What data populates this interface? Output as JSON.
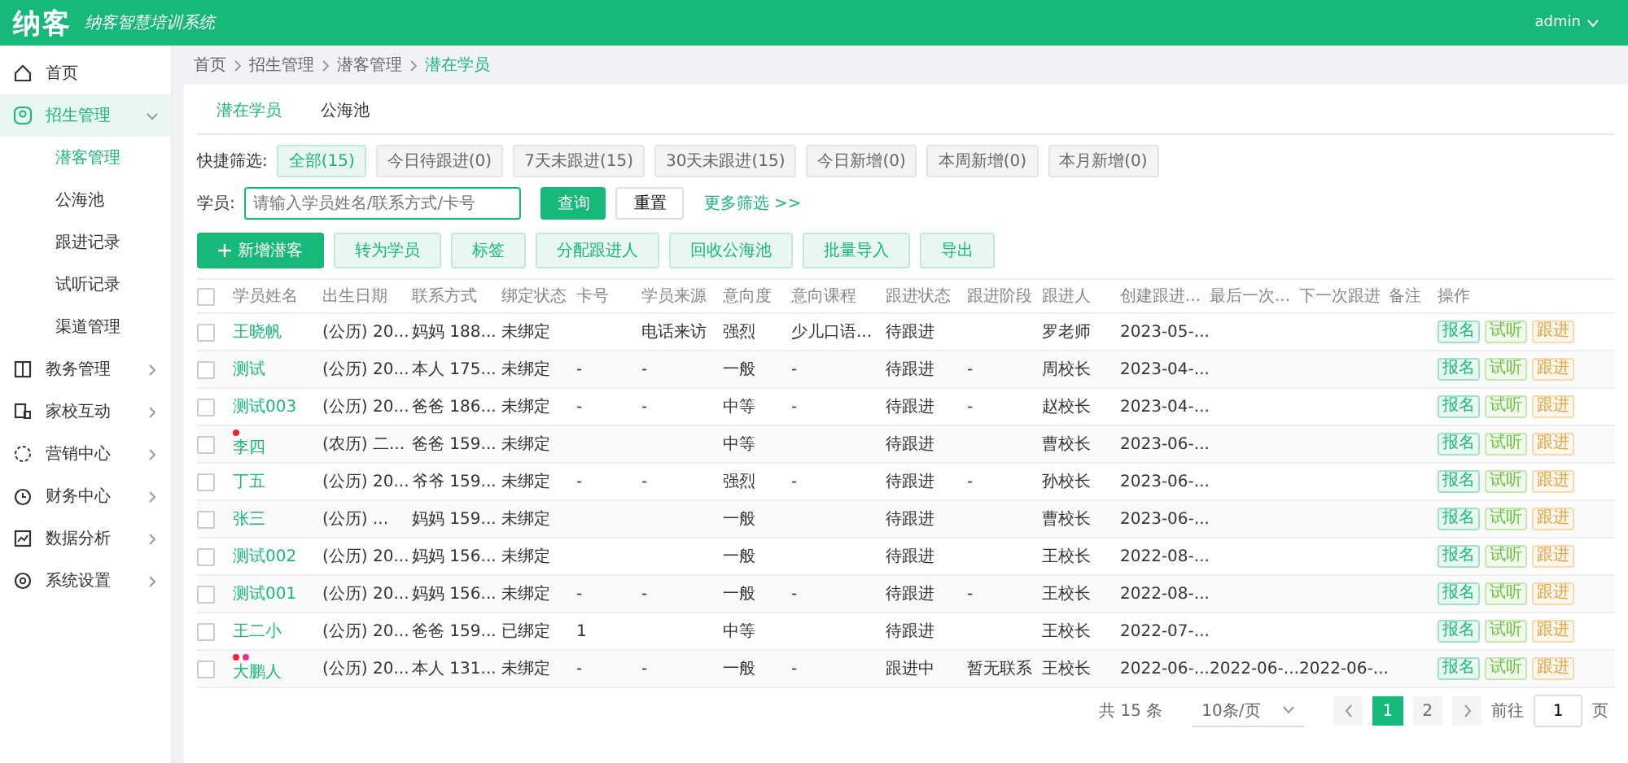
{
  "header": {
    "logo": "纳客",
    "slogan": "纳客智慧培训系统",
    "user": "admin"
  },
  "sidebar": {
    "items": [
      {
        "label": "首页",
        "expanded": false,
        "has_children": false
      },
      {
        "label": "招生管理",
        "expanded": true,
        "has_children": true,
        "children": [
          {
            "label": "潜客管理",
            "selected": true
          },
          {
            "label": "公海池",
            "selected": false
          },
          {
            "label": "跟进记录",
            "selected": false
          },
          {
            "label": "试听记录",
            "selected": false
          },
          {
            "label": "渠道管理",
            "selected": false
          }
        ]
      },
      {
        "label": "教务管理",
        "expanded": false,
        "has_children": true
      },
      {
        "label": "家校互动",
        "expanded": false,
        "has_children": true
      },
      {
        "label": "营销中心",
        "expanded": false,
        "has_children": true
      },
      {
        "label": "财务中心",
        "expanded": false,
        "has_children": true
      },
      {
        "label": "数据分析",
        "expanded": false,
        "has_children": true
      },
      {
        "label": "系统设置",
        "expanded": false,
        "has_children": true
      }
    ]
  },
  "breadcrumb": [
    "首页",
    "招生管理",
    "潜客管理",
    "潜在学员"
  ],
  "tabs": [
    {
      "label": "潜在学员",
      "selected": true
    },
    {
      "label": "公海池",
      "selected": false
    }
  ],
  "quick_filter": {
    "label": "快捷筛选:",
    "chips": [
      {
        "label": "全部(15)",
        "selected": true
      },
      {
        "label": "今日待跟进(0)",
        "selected": false
      },
      {
        "label": "7天未跟进(15)",
        "selected": false
      },
      {
        "label": "30天未跟进(15)",
        "selected": false
      },
      {
        "label": "今日新增(0)",
        "selected": false
      },
      {
        "label": "本周新增(0)",
        "selected": false
      },
      {
        "label": "本月新增(0)",
        "selected": false
      }
    ]
  },
  "search": {
    "label": "学员:",
    "placeholder": "请输入学员姓名/联系方式/卡号",
    "query_button": "查询",
    "reset_button": "重置",
    "more_filters": "更多筛选 >>"
  },
  "actions": [
    {
      "label": "新增潜客",
      "kind": "primary"
    },
    {
      "label": "转为学员",
      "kind": "secondary"
    },
    {
      "label": "标签",
      "kind": "secondary"
    },
    {
      "label": "分配跟进人",
      "kind": "secondary"
    },
    {
      "label": "回收公海池",
      "kind": "secondary"
    },
    {
      "label": "批量导入",
      "kind": "secondary"
    },
    {
      "label": "导出",
      "kind": "secondary"
    }
  ],
  "table": {
    "select_all_checked": false,
    "columns": [
      "学员姓名",
      "出生日期",
      "联系方式",
      "绑定状态",
      "卡号",
      "学员来源",
      "意向度",
      "意向课程",
      "跟进状态",
      "跟进阶段",
      "跟进人",
      "创建跟进...",
      "最后一次...",
      "下一次跟进",
      "备注",
      "操作"
    ],
    "rows": [
      {
        "checked": false,
        "tags": [],
        "actions": [
          {
            "label": "报名",
            "kind": "enroll"
          },
          {
            "label": "试听",
            "kind": "trial"
          },
          {
            "label": "跟进",
            "kind": "follow"
          }
        ],
        "cells": [
          "王晓帆",
          "(公历) 20...",
          "妈妈 188...",
          "未绑定",
          "",
          "电话来访",
          "强烈",
          "少儿口语...",
          "待跟进",
          "",
          "罗老师",
          "2023-05-...",
          "",
          "",
          ""
        ]
      },
      {
        "checked": false,
        "tags": [],
        "actions": [
          {
            "label": "报名",
            "kind": "enroll"
          },
          {
            "label": "试听",
            "kind": "trial"
          },
          {
            "label": "跟进",
            "kind": "follow"
          }
        ],
        "cells": [
          "测试",
          "(公历) 20...",
          "本人 175...",
          "未绑定",
          "-",
          "-",
          "一般",
          "-",
          "待跟进",
          "-",
          "周校长",
          "2023-04-...",
          "",
          "",
          ""
        ]
      },
      {
        "checked": false,
        "tags": [],
        "actions": [
          {
            "label": "报名",
            "kind": "enroll"
          },
          {
            "label": "试听",
            "kind": "trial"
          },
          {
            "label": "跟进",
            "kind": "follow"
          }
        ],
        "cells": [
          "测试003",
          "(公历) 20...",
          "爸爸 186...",
          "未绑定",
          "-",
          "-",
          "中等",
          "-",
          "待跟进",
          "-",
          "赵校长",
          "2023-04-...",
          "",
          "",
          ""
        ]
      },
      {
        "checked": false,
        "tags": [
          {
            "color": "#f5222d"
          }
        ],
        "actions": [
          {
            "label": "报名",
            "kind": "enroll"
          },
          {
            "label": "试听",
            "kind": "trial"
          },
          {
            "label": "跟进",
            "kind": "follow"
          }
        ],
        "cells": [
          "李四",
          "(农历) 二...",
          "爸爸 159...",
          "未绑定",
          "",
          "",
          "中等",
          "",
          "待跟进",
          "",
          "曹校长",
          "2023-06-...",
          "",
          "",
          ""
        ]
      },
      {
        "checked": false,
        "tags": [],
        "actions": [
          {
            "label": "报名",
            "kind": "enroll"
          },
          {
            "label": "试听",
            "kind": "trial"
          },
          {
            "label": "跟进",
            "kind": "follow"
          }
        ],
        "cells": [
          "丁五",
          "(公历) 20...",
          "爷爷 159...",
          "未绑定",
          "-",
          "-",
          "强烈",
          "-",
          "待跟进",
          "-",
          "孙校长",
          "2023-06-...",
          "",
          "",
          ""
        ]
      },
      {
        "checked": false,
        "tags": [],
        "actions": [
          {
            "label": "报名",
            "kind": "enroll"
          },
          {
            "label": "试听",
            "kind": "trial"
          },
          {
            "label": "跟进",
            "kind": "follow"
          }
        ],
        "cells": [
          "张三",
          "(公历) ...",
          "妈妈 159...",
          "未绑定",
          "",
          "",
          "一般",
          "",
          "待跟进",
          "",
          "曹校长",
          "2023-06-...",
          "",
          "",
          ""
        ]
      },
      {
        "checked": false,
        "tags": [],
        "actions": [
          {
            "label": "报名",
            "kind": "enroll"
          },
          {
            "label": "试听",
            "kind": "trial"
          },
          {
            "label": "跟进",
            "kind": "follow"
          }
        ],
        "cells": [
          "测试002",
          "(公历) 20...",
          "妈妈 156...",
          "未绑定",
          "",
          "",
          "一般",
          "",
          "待跟进",
          "",
          "王校长",
          "2022-08-...",
          "",
          "",
          ""
        ]
      },
      {
        "checked": false,
        "tags": [],
        "actions": [
          {
            "label": "报名",
            "kind": "enroll"
          },
          {
            "label": "试听",
            "kind": "trial"
          },
          {
            "label": "跟进",
            "kind": "follow"
          }
        ],
        "cells": [
          "测试001",
          "(公历) 20...",
          "妈妈 156...",
          "未绑定",
          "-",
          "-",
          "一般",
          "-",
          "待跟进",
          "-",
          "王校长",
          "2022-08-...",
          "",
          "",
          ""
        ]
      },
      {
        "checked": false,
        "tags": [],
        "actions": [
          {
            "label": "报名",
            "kind": "enroll"
          },
          {
            "label": "试听",
            "kind": "trial"
          },
          {
            "label": "跟进",
            "kind": "follow"
          }
        ],
        "cells": [
          "王二小",
          "(公历) 20...",
          "爸爸 159...",
          "已绑定",
          "1",
          "",
          "中等",
          "",
          "待跟进",
          "",
          "王校长",
          "2022-07-...",
          "",
          "",
          ""
        ]
      },
      {
        "checked": false,
        "tags": [
          {
            "color": "#f5222d"
          },
          {
            "color": "#eb2f96"
          }
        ],
        "actions": [
          {
            "label": "报名",
            "kind": "enroll"
          },
          {
            "label": "试听",
            "kind": "trial"
          },
          {
            "label": "跟进",
            "kind": "follow"
          }
        ],
        "cells": [
          "大鹏人",
          "(公历) 20...",
          "本人 131...",
          "未绑定",
          "-",
          "-",
          "一般",
          "-",
          "跟进中",
          "暂无联系",
          "王校长",
          "2022-06-...",
          "2022-06-...",
          "2022-06-...",
          ""
        ]
      }
    ]
  },
  "pagination": {
    "total": "共 15 条",
    "page_size": "10条/页",
    "pages": [
      {
        "label": "1",
        "selected": true
      },
      {
        "label": "2",
        "selected": false
      }
    ],
    "goto_label": "前往",
    "goto_value": "1",
    "page_suffix": "页"
  }
}
